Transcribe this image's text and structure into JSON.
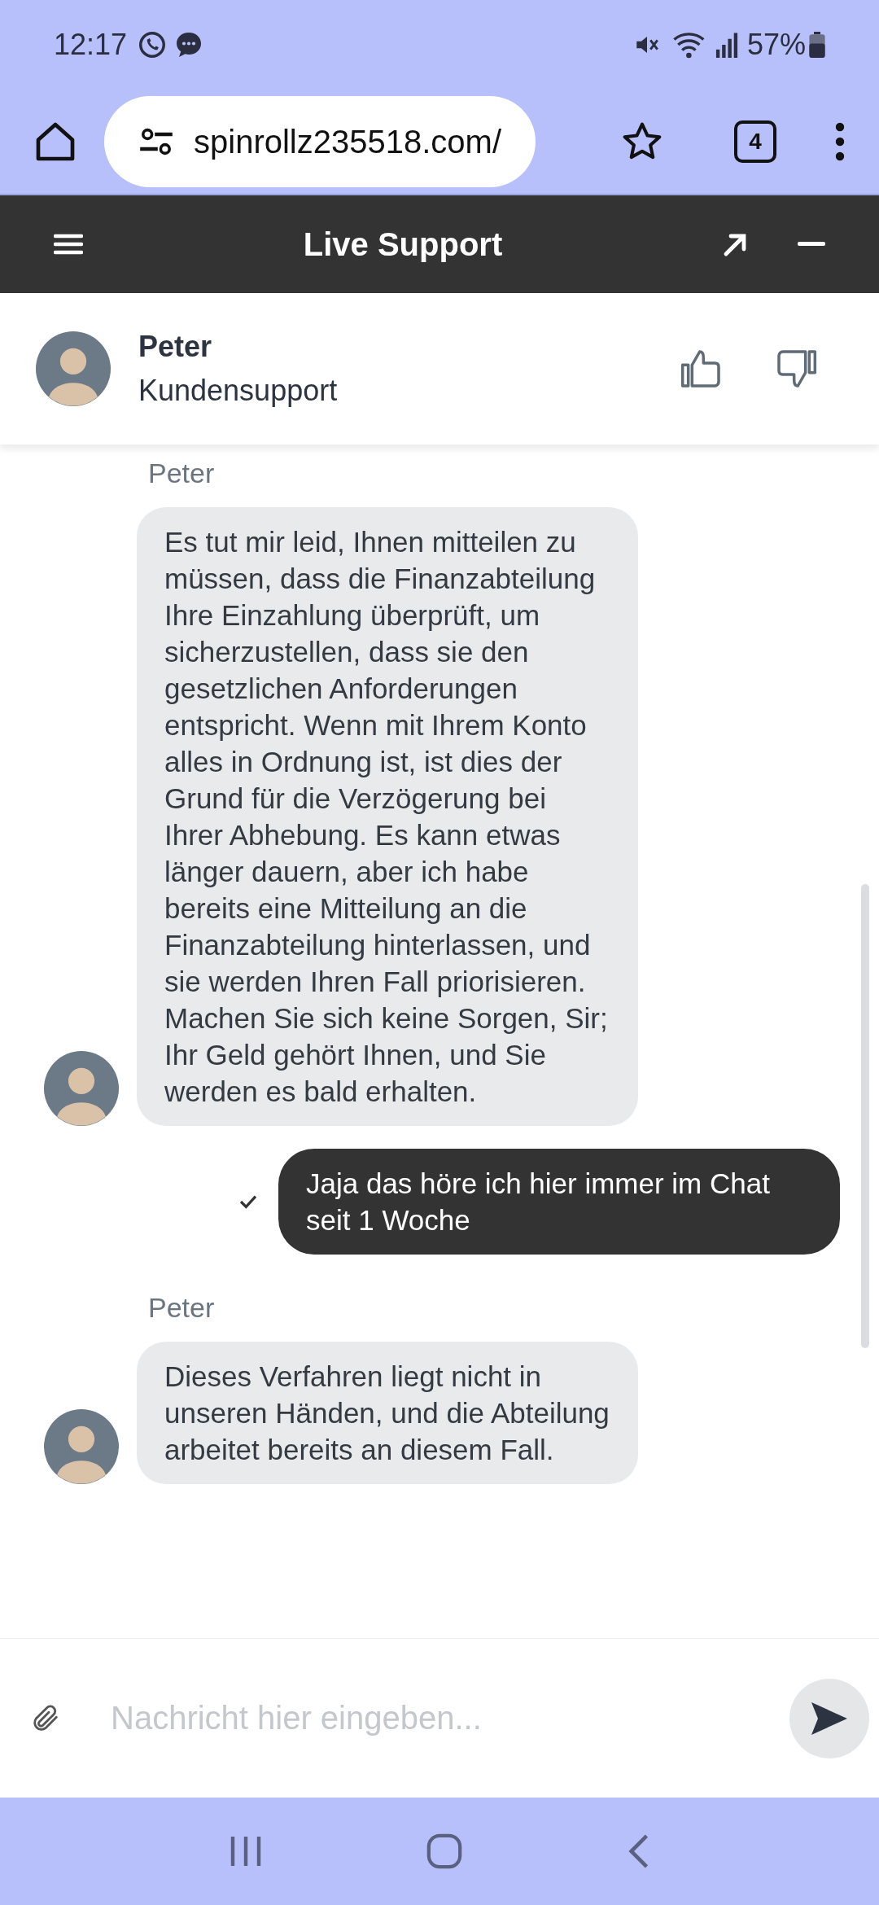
{
  "status_bar": {
    "time": "12:17",
    "battery": "57%"
  },
  "browser": {
    "url": "spinrollz235518.com/",
    "tab_count": "4"
  },
  "widget": {
    "title": "Live Support"
  },
  "agent": {
    "name": "Peter",
    "role": "Kundensupport"
  },
  "messages": [
    {
      "kind": "agent",
      "sender": "Peter",
      "text": "Es tut mir leid, Ihnen mitteilen zu müssen, dass die Finanzabteilung Ihre Einzahlung überprüft, um sicherzustellen, dass sie den gesetzlichen Anforderungen entspricht. Wenn mit Ihrem Konto alles in Ordnung ist, ist dies der Grund für die Verzögerung bei Ihrer Abhebung. Es kann etwas länger dauern, aber ich habe bereits eine Mitteilung an die Finanzabteilung hinterlassen, und sie werden Ihren Fall priorisieren. Machen Sie sich keine Sorgen, Sir; Ihr Geld gehört Ihnen, und Sie werden es bald erhalten."
    },
    {
      "kind": "user",
      "text": "Jaja das höre ich hier immer im Chat seit 1 Woche",
      "delivered": true
    },
    {
      "kind": "agent",
      "sender": "Peter",
      "text": "Dieses Verfahren liegt nicht in unseren Händen, und die Abteilung arbeitet bereits an diesem Fall."
    }
  ],
  "composer": {
    "placeholder": "Nachricht hier eingeben..."
  }
}
